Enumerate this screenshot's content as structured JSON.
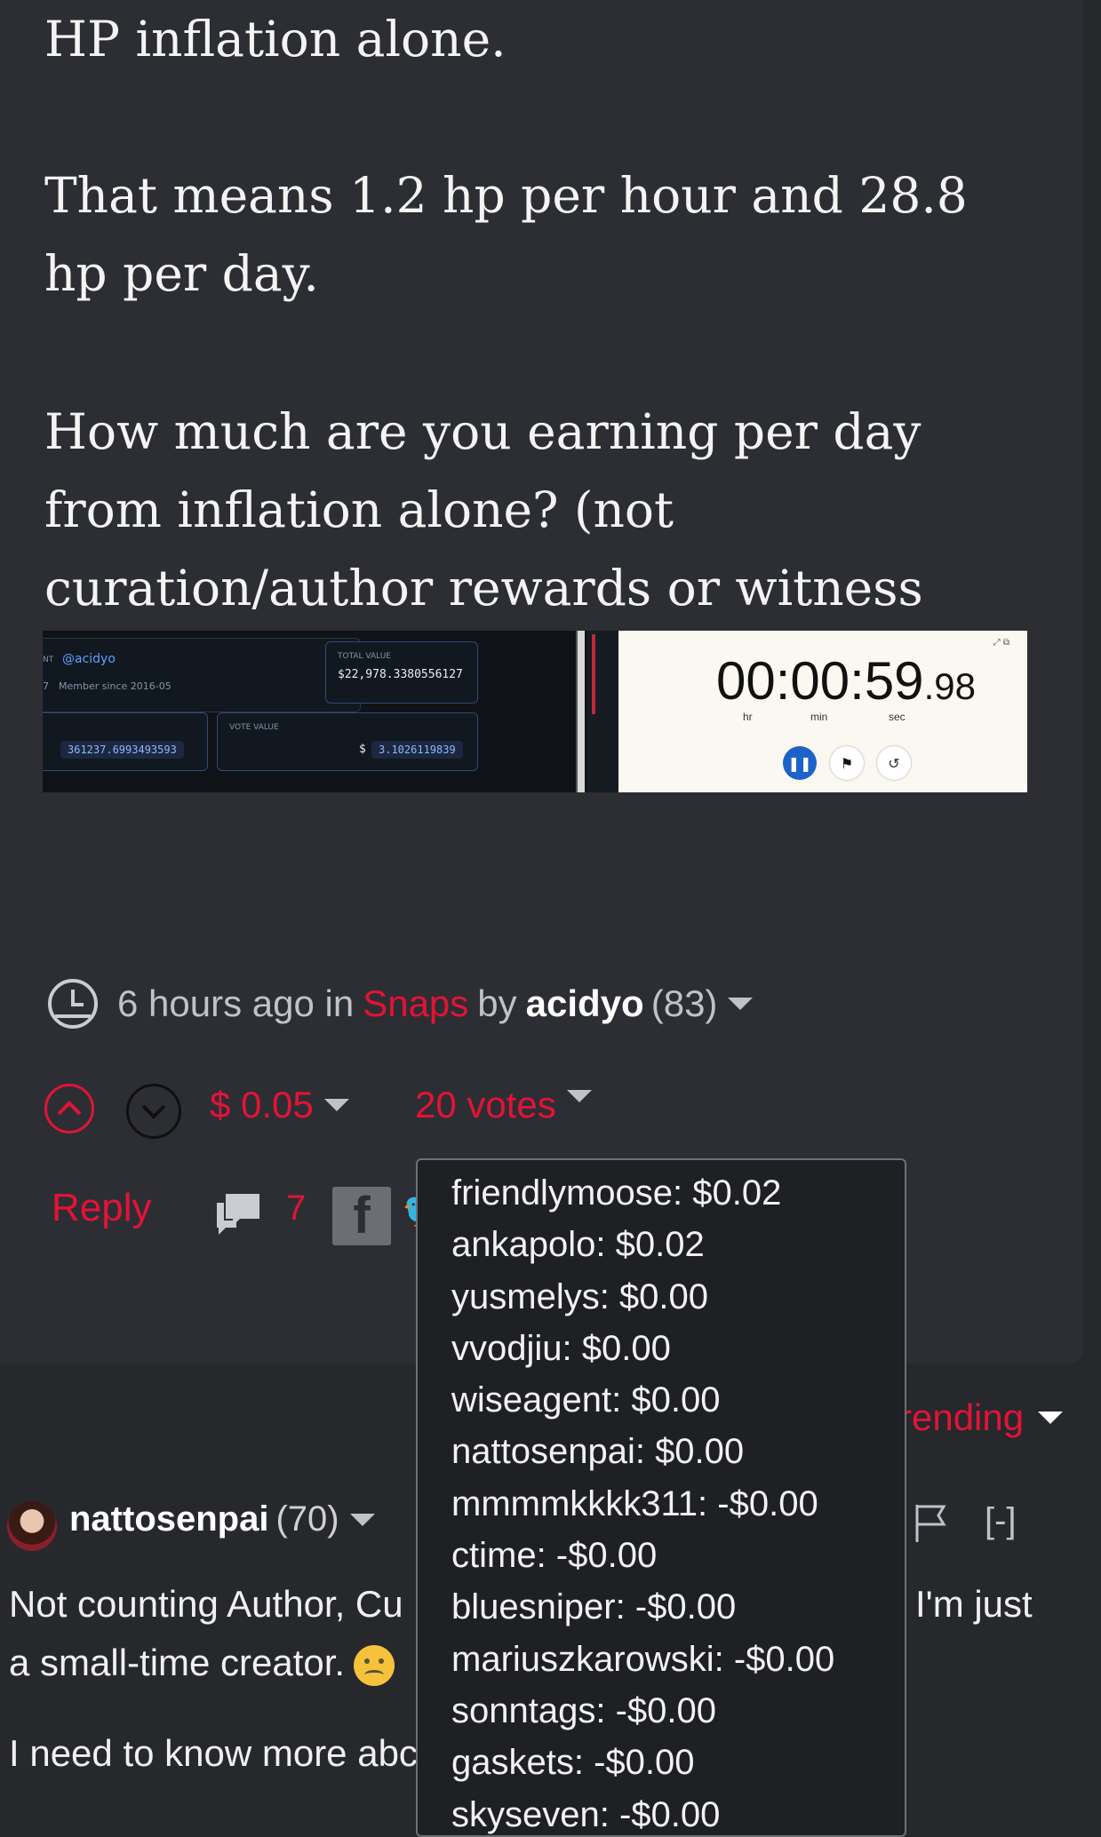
{
  "post": {
    "paragraphs": [
      "HP inflation alone.",
      "That means 1.2 hp per hour and 28.8 hp per day.",
      "How much are you earning per day from inflation alone? (not curation/author rewards or witness rewards)"
    ],
    "screenshot": {
      "account_prefix": "NT",
      "username": "@acidyo",
      "member_since": "Member since 2016-05",
      "member_prefix": "7",
      "total_value_label": "TOTAL VALUE",
      "total_value": "$22,978.3380556127",
      "vote_value_label": "VOTE VALUE",
      "vote_value_currency": "$",
      "vote_value": "3.1026119839",
      "hp_value": "361237.6993493593",
      "stopwatch": {
        "time_main": "00:00:59",
        "time_frac": ".98",
        "label_hr": "hr",
        "label_min": "min",
        "label_sec": "sec"
      }
    },
    "meta": {
      "time": "6 hours ago in",
      "community": "Snaps",
      "by": "by",
      "author": "acidyo",
      "reputation": "(83)"
    },
    "payout": "$ 0.05",
    "votes_label": "20 votes",
    "reply_label": "Reply",
    "comment_count": "7"
  },
  "votes_popup": [
    "friendlymoose: $0.02",
    "ankapolo: $0.02",
    "yusmelys: $0.00",
    "vvodjiu: $0.00",
    "wiseagent: $0.00",
    "nattosenpai: $0.00",
    "mmmmkkkk311: -$0.00",
    "ctime: -$0.00",
    "bluesniper: -$0.00",
    "mariuszkarowski: -$0.00",
    "sonntags: -$0.00",
    "gaskets: -$0.00",
    "skyseven: -$0.00"
  ],
  "sort_label": "rending",
  "comment": {
    "author": "nattosenpai",
    "reputation": "(70)",
    "collapse": "[-]",
    "line1_left": "Not counting Author, Cu",
    "line1_right": "I'm just",
    "line2_left": "a small-time creator.",
    "line3_left": "I need to know more abc"
  },
  "colors": {
    "accent": "#e31337",
    "background": "#2c2e33",
    "popup_bg": "#1f2024"
  }
}
